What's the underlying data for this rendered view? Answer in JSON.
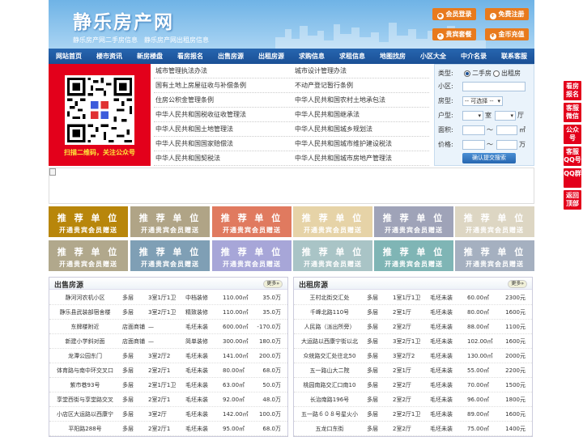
{
  "header": {
    "site_title": "静乐房产网",
    "subtitle": "静乐房产网二手房信息　静乐房产网出租房信息",
    "buttons": [
      {
        "label": "会员登录",
        "icon": "user-icon"
      },
      {
        "label": "免费注册",
        "icon": "person-add-icon"
      },
      {
        "label": "贵宾套餐",
        "icon": "vip-icon"
      },
      {
        "label": "金币充值",
        "icon": "coin-icon"
      }
    ]
  },
  "nav": [
    "网站首页",
    "楼市资讯",
    "新房楼盘",
    "看房报名",
    "出售房源",
    "出租房源",
    "求购信息",
    "求租信息",
    "地图找房",
    "小区大全",
    "中介名录",
    "联系客服"
  ],
  "qr": {
    "caption": "扫描二维码，关注公众号"
  },
  "links": {
    "left": [
      "城市管理执法办法",
      "国有土地上房屋征收与补偿条例",
      "住房公积金管理条例",
      "中华人民共和国税收征收管理法",
      "中华人民共和国土地管理法",
      "中华人民共和国国家赔偿法",
      "中华人民共和国契税法"
    ],
    "right": [
      "城市设计管理办法",
      "不动产登记暂行条例",
      "中华人民共和国农村土地承包法",
      "中华人民共和国继承法",
      "中华人民共和国城乡规划法",
      "中华人民共和国城市维护建设税法",
      "中华人民共和国城市房地产管理法"
    ]
  },
  "search": {
    "type_label": "类型:",
    "type_options": [
      "二手房",
      "出租房"
    ],
    "community_label": "小区:",
    "housetype_label": "房型:",
    "housetype_value": "-- 可选择 --",
    "layout_label": "户型:",
    "room_suffix": "室",
    "hall_suffix": "厅",
    "area_label": "面积:",
    "area_unit": "㎡",
    "range_sep": "〜",
    "price_label": "价格:",
    "price_unit": "万",
    "submit": "确认提交搜索"
  },
  "ads": {
    "line1": "推 荐 单 位",
    "line2": "开通贵宾会员赠送",
    "colors": [
      "#b8860b",
      "#b0a486",
      "#e07a5f",
      "#e6d3a7",
      "#9fa3b8",
      "#ddd6c3",
      "#b1a88c",
      "#7f9fb5",
      "#a7a6d8",
      "#a9c4c6",
      "#7fb5b5",
      "#a5b0c0"
    ]
  },
  "sale": {
    "title": "出售房源",
    "more": "更多»",
    "rows": [
      [
        "静河河农机小区",
        "多层",
        "3室1厅1卫",
        "中档装修",
        "110.00㎡",
        "35.0万"
      ],
      [
        "静乐县武装部宿舍楼",
        "多层",
        "3室2厅1卫",
        "精致装修",
        "110.00㎡",
        "35.0万"
      ],
      [
        "东牌楼附近",
        "店面商铺",
        "—",
        "毛坯未装",
        "600.00㎡",
        "-170.0万"
      ],
      [
        "新建小学斜对面",
        "店面商铺",
        "—",
        "简单装修",
        "300.00㎡",
        "180.0万"
      ],
      [
        "龙潭公园东门",
        "多层",
        "3室2厅2",
        "毛坯未装",
        "141.00㎡",
        "200.0万"
      ],
      [
        "体育路与南中环交叉口",
        "多层",
        "2室2厅1",
        "毛坯未装",
        "80.00㎡",
        "68.0万"
      ],
      [
        "紫市巷93号",
        "多层",
        "2室1厅1卫",
        "毛坯未装",
        "63.00㎡",
        "50.0万"
      ],
      [
        "享堂西街与享堂路交叉",
        "多层",
        "2室2厅1",
        "毛坯未装",
        "92.00㎡",
        "48.0万"
      ],
      [
        "小店区大运路以西康宁",
        "多层",
        "3室2厅",
        "毛坯未装",
        "142.00㎡",
        "100.0万"
      ],
      [
        "平阳路288号",
        "多层",
        "2室2厅1",
        "毛坯未装",
        "95.00㎡",
        "68.0万"
      ]
    ]
  },
  "rent": {
    "title": "出租房源",
    "more": "更多»",
    "rows": [
      [
        "王村北街交汇处",
        "多层",
        "1室1厅1卫",
        "毛坯未装",
        "60.00㎡",
        "2300元"
      ],
      [
        "千峰北路110号",
        "多层",
        "2室1厅",
        "毛坯未装",
        "80.00㎡",
        "1600元"
      ],
      [
        "人民路（派出所旁）",
        "多层",
        "2室2厅",
        "毛坯未装",
        "88.00㎡",
        "1100元"
      ],
      [
        "大运路以西康宁街以北",
        "多层",
        "3室2厅1卫",
        "毛坯未装",
        "102.00㎡",
        "1600元"
      ],
      [
        "众统路交汇处往北50",
        "多层",
        "3室2厅2",
        "毛坯未装",
        "130.00㎡",
        "2000元"
      ],
      [
        "五一路山大二院",
        "多层",
        "2室1厅",
        "毛坯未装",
        "55.00㎡",
        "2200元"
      ],
      [
        "桃园南路交汇口南10",
        "多层",
        "2室2厅",
        "毛坯未装",
        "70.00㎡",
        "1500元"
      ],
      [
        "长治南路196号",
        "多层",
        "2室2厅",
        "毛坯未装",
        "96.00㎡",
        "1800元"
      ],
      [
        "五一路６０８号星火小",
        "多层",
        "2室2厅1卫",
        "毛坯未装",
        "89.00㎡",
        "1600元"
      ],
      [
        "五龙口东街",
        "多层",
        "2室2厅",
        "毛坯未装",
        "75.00㎡",
        "1400元"
      ]
    ]
  },
  "sidebar": [
    "看房报名",
    "客服微信",
    "公众号",
    "客服QQ号",
    "QQ群",
    "返回顶部"
  ]
}
